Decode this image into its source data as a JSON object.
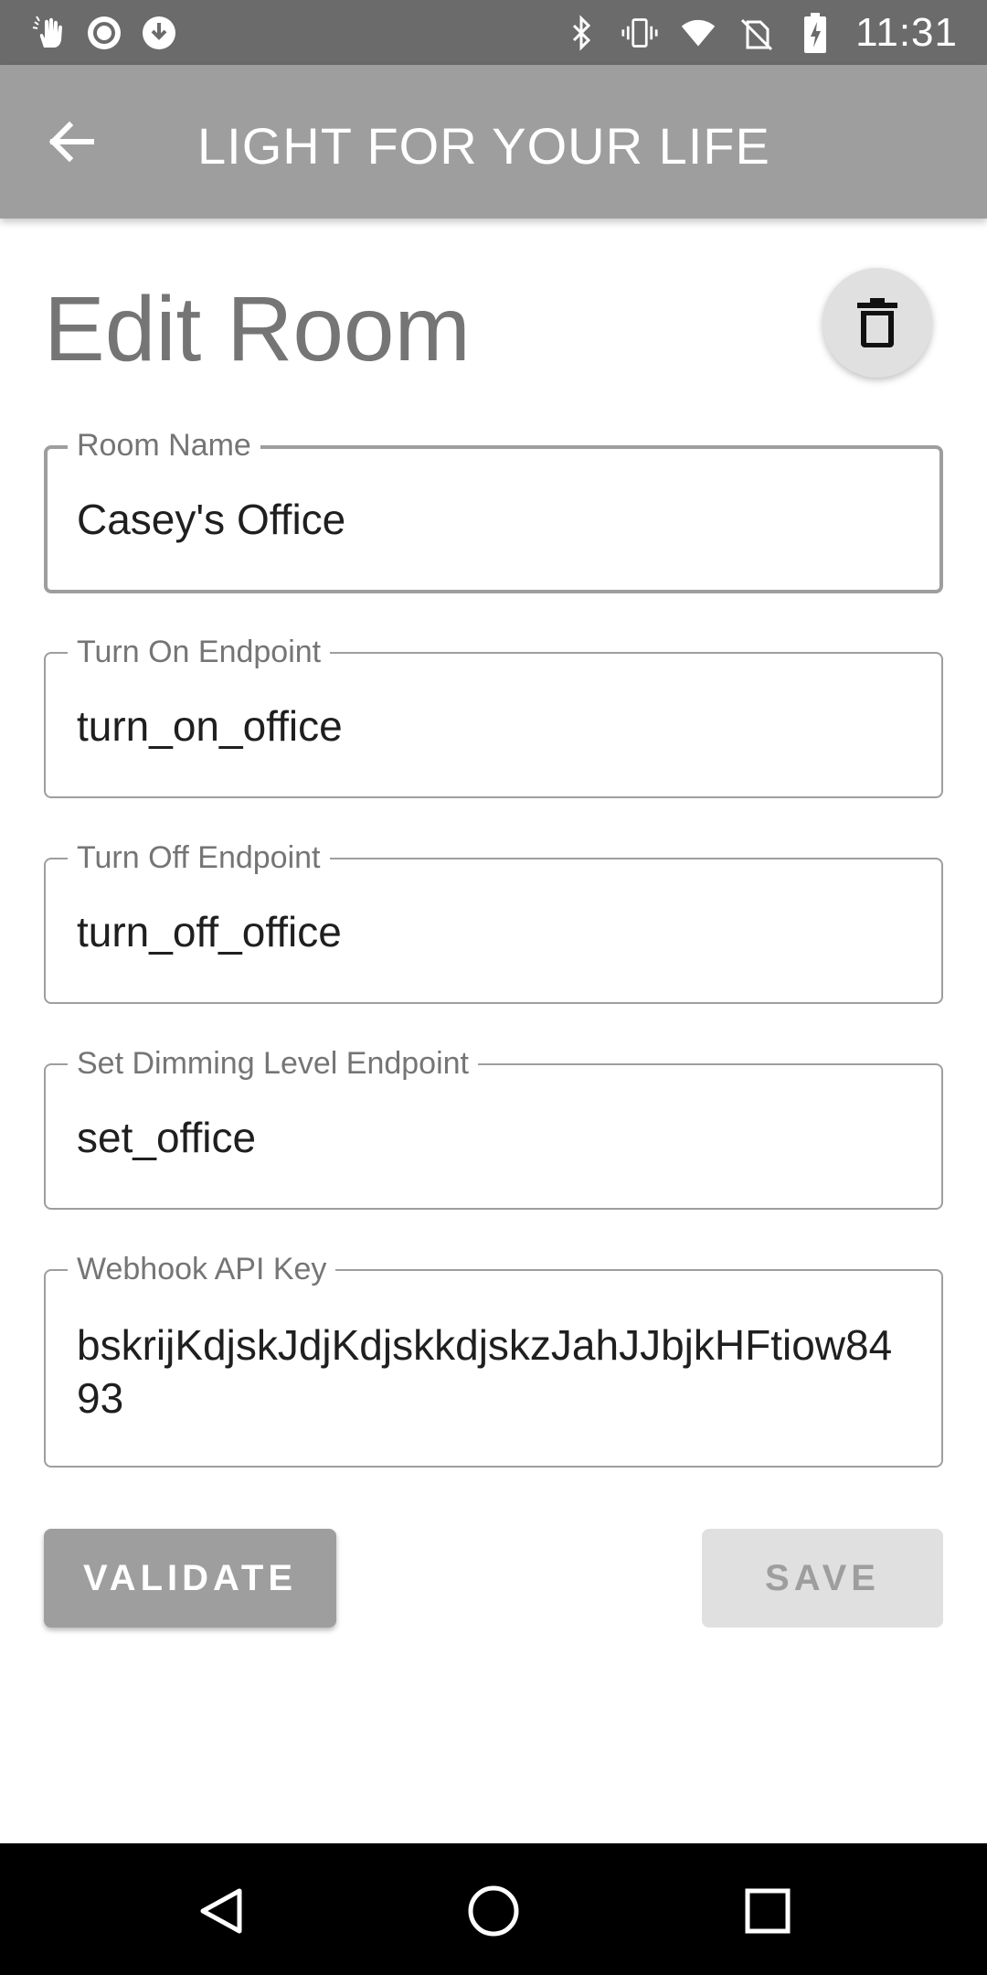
{
  "status_bar": {
    "time": "11:31",
    "left_icons": [
      "touch-hand-icon",
      "record-circle-icon",
      "download-arrow-icon"
    ],
    "right_icons": [
      "bluetooth-icon",
      "vibrate-icon",
      "wifi-icon",
      "no-sim-icon",
      "battery-charging-icon"
    ]
  },
  "app_bar": {
    "title": "LIGHT FOR YOUR LIFE",
    "back_icon": "arrow-back-icon"
  },
  "page": {
    "title": "Edit Room",
    "delete_icon": "trash-icon"
  },
  "form": {
    "room_name": {
      "label": "Room Name",
      "value": "Casey's Office"
    },
    "turn_on": {
      "label": "Turn On Endpoint",
      "value": "turn_on_office"
    },
    "turn_off": {
      "label": "Turn Off Endpoint",
      "value": "turn_off_office"
    },
    "dimming": {
      "label": "Set Dimming Level Endpoint",
      "value": "set_office"
    },
    "api_key": {
      "label": "Webhook API Key",
      "value": "bskrijKdjskJdjKdjskkdjskzJahJJbjkHFtiow8493"
    }
  },
  "actions": {
    "validate_label": "VALIDATE",
    "save_label": "SAVE"
  },
  "nav_bar": {
    "icons": [
      "nav-back-icon",
      "nav-home-icon",
      "nav-recents-icon"
    ]
  },
  "colors": {
    "status_bar": "#6b6b6b",
    "app_bar": "#9e9e9e",
    "title_text": "#757575",
    "field_border": "#9e9e9e",
    "validate_button": "#9e9e9e",
    "save_button_disabled": "#e0e0e0",
    "nav_bar": "#000000"
  }
}
